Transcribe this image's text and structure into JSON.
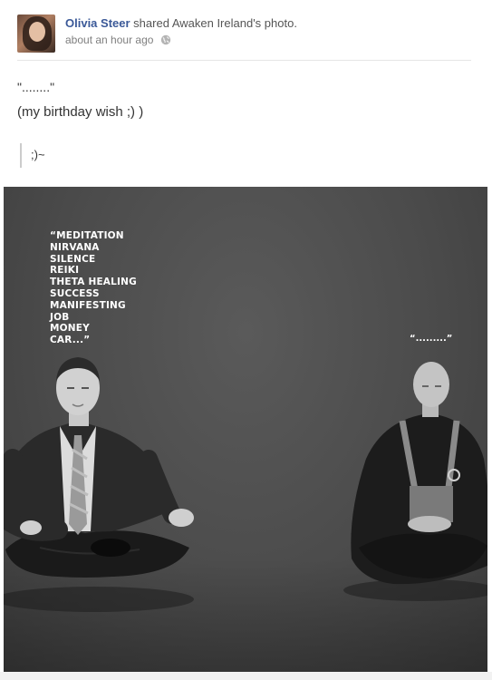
{
  "post": {
    "author": "Olivia Steer",
    "action": "shared Awaken Ireland's photo.",
    "timestamp": "about an hour ago",
    "privacy_icon": "globe-icon",
    "status_line1": "\"........\"",
    "status_line2": "(my birthday wish ;) )",
    "quote": ";)~"
  },
  "photo": {
    "man_thoughts": [
      "“MEDITATION",
      "NIRVANA",
      "SILENCE",
      "REIKI",
      "THETA HEALING",
      "SUCCESS",
      "MANIFESTING",
      "JOB",
      "MONEY",
      "CAR...”"
    ],
    "monk_thought": "“.........”"
  },
  "colors": {
    "link": "#3b5998",
    "photo_bg": "#4b4b4b"
  }
}
